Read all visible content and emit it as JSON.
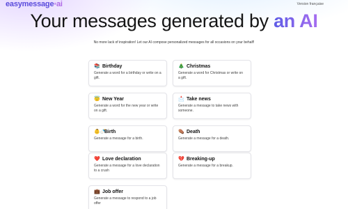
{
  "header": {
    "logo_main": "easymessage",
    "logo_dot": "•",
    "logo_ai": "ai",
    "language_link": "Version française"
  },
  "hero": {
    "title_start": "Your messages generated by",
    "title_accent": "an AI",
    "tagline": "No more lack of inspiration! Let our AI compose personalized messages for all occasions on your behalf!"
  },
  "cards": [
    {
      "icon": "📚",
      "icon_name": "books-icon",
      "title": "Birthday",
      "description": "Generate a word for a birthday or write on a gift."
    },
    {
      "icon": "🎄",
      "icon_name": "christmas-tree-icon",
      "title": "Christmas",
      "description": "Generate a word for Christmas or write on a gift."
    },
    {
      "icon": "😇",
      "icon_name": "smiling-face-halo-icon",
      "title": "New Year",
      "description": "Generate a word for the new year or write on a gift."
    },
    {
      "icon": "📩",
      "icon_name": "envelope-icon",
      "title": "Take news",
      "description": "Generate a message to take news with someone."
    },
    {
      "icon": "👶🍼",
      "icon_name": "baby-bottle-icon",
      "title": "Birth",
      "description": "Generate a message for a birth."
    },
    {
      "icon": "⚰️",
      "icon_name": "coffin-icon",
      "title": "Death",
      "description": "Generate a message for a death."
    },
    {
      "icon": "❤️",
      "icon_name": "red-heart-icon",
      "title": "Love declaration",
      "description": "Generate a message for a love declaration to a crush"
    },
    {
      "icon": "💔",
      "icon_name": "broken-heart-icon",
      "title": "Breaking-up",
      "description": "Generate a message for a breakup."
    },
    {
      "icon": "💼",
      "icon_name": "briefcase-icon",
      "title": "Job offer",
      "description": "Generate a message to respond to a job offer"
    }
  ]
}
